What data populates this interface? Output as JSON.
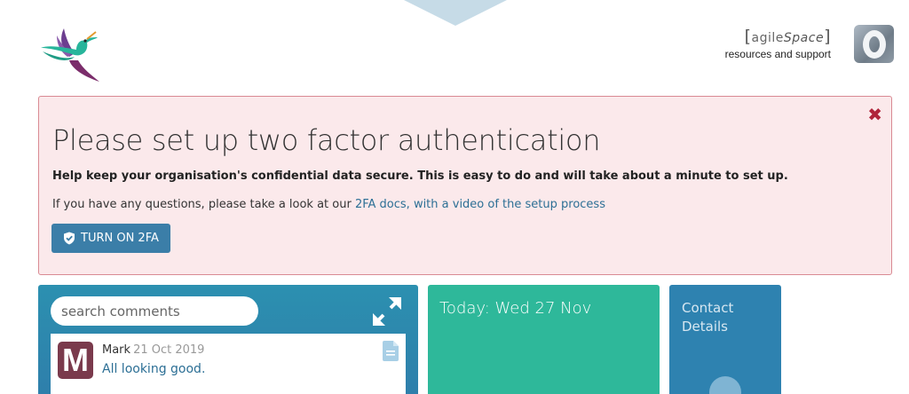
{
  "header": {
    "brand_left_bracket": "[",
    "brand_agile": "agile",
    "brand_space": "Space",
    "brand_right_bracket": "]",
    "brand_subtitle": "resources and support",
    "logo_icon": "hummingbird-logo",
    "account_icon": "letter-o-avatar"
  },
  "alert": {
    "title": "Please set up two factor authentication",
    "bold_text": "Help keep your organisation's confidential data secure. This is easy to do and will take about a minute to set up.",
    "info_prefix": "If you have any questions, please take a look at our ",
    "info_link": "2FA docs, with a video of the setup process",
    "button_label": "TURN ON 2FA",
    "close_symbol": "✖",
    "colors": {
      "background": "#fbe9eb",
      "border": "#d98a93",
      "close": "#b0253b",
      "button": "#3b7ea8"
    }
  },
  "comments_panel": {
    "search_placeholder": "search comments",
    "comments": [
      {
        "initial": "M",
        "author": "Mark",
        "date": "21 Oct 2019",
        "text": "All looking good."
      }
    ],
    "color": "#2e7fab"
  },
  "today_panel": {
    "label": "Today: Wed 27 Nov",
    "color": "#2eb89a"
  },
  "contact_panel": {
    "label": "Contact Details",
    "color": "#2e82b0"
  }
}
